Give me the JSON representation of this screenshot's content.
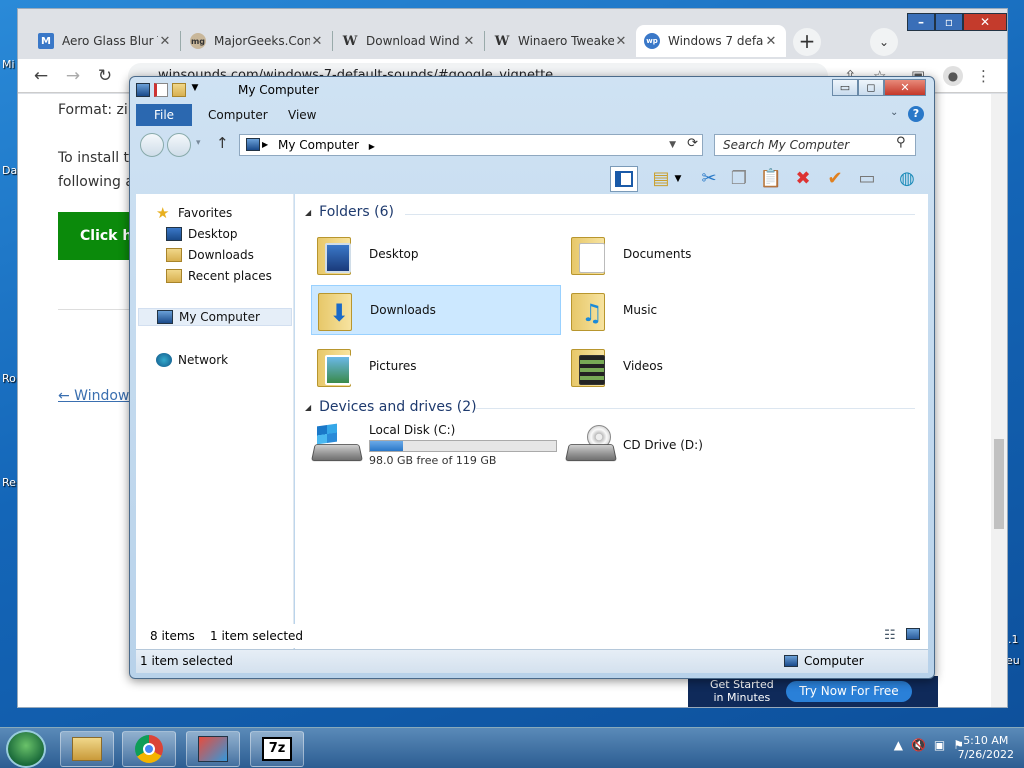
{
  "desktop": {
    "labels": [
      "Mi",
      "Da",
      "Ro",
      "Re",
      ".1",
      "eu"
    ]
  },
  "browser": {
    "tabs": [
      {
        "title": "Aero Glass Blur T",
        "icon": "M"
      },
      {
        "title": "MajorGeeks.Con",
        "icon": "mg"
      },
      {
        "title": "Download Wind",
        "icon": "W"
      },
      {
        "title": "Winaero Tweake",
        "icon": "W"
      },
      {
        "title": "Windows 7 defa",
        "icon": "wp"
      }
    ],
    "url": "winsounds.com/windows-7-default-sounds/#google_vignette"
  },
  "page": {
    "format_text": "Format: zip archive",
    "install_text_1": "To install th",
    "install_text_2": "following ar",
    "click_button": "Click he",
    "windows_link": "← Windows",
    "ad_line1": "Get Started",
    "ad_line2": "in Minutes",
    "ad_button": "Try Now For Free"
  },
  "explorer": {
    "title": "My Computer",
    "ribbon_tabs": [
      "File",
      "Computer",
      "View"
    ],
    "address": "My Computer",
    "search_placeholder": "Search My Computer",
    "nav": {
      "favorites": "Favorites",
      "fav_items": [
        "Desktop",
        "Downloads",
        "Recent places"
      ],
      "my_computer": "My Computer",
      "network": "Network"
    },
    "groups": {
      "folders": "Folders (6)",
      "devices": "Devices and drives (2)"
    },
    "folders": [
      "Desktop",
      "Documents",
      "Downloads",
      "Music",
      "Pictures",
      "Videos"
    ],
    "drives": {
      "local_name": "Local Disk (C:)",
      "local_free": "98.0 GB free of 119 GB",
      "local_used_fraction": 0.18,
      "cd_name": "CD Drive (D:)"
    },
    "status": {
      "items": "8 items",
      "selected": "1 item selected",
      "bottom_selected": "1 item selected",
      "bottom_location": "Computer"
    }
  },
  "taskbar": {
    "time": "5:10 AM",
    "date": "7/26/2022",
    "sevenzip": "7z"
  }
}
